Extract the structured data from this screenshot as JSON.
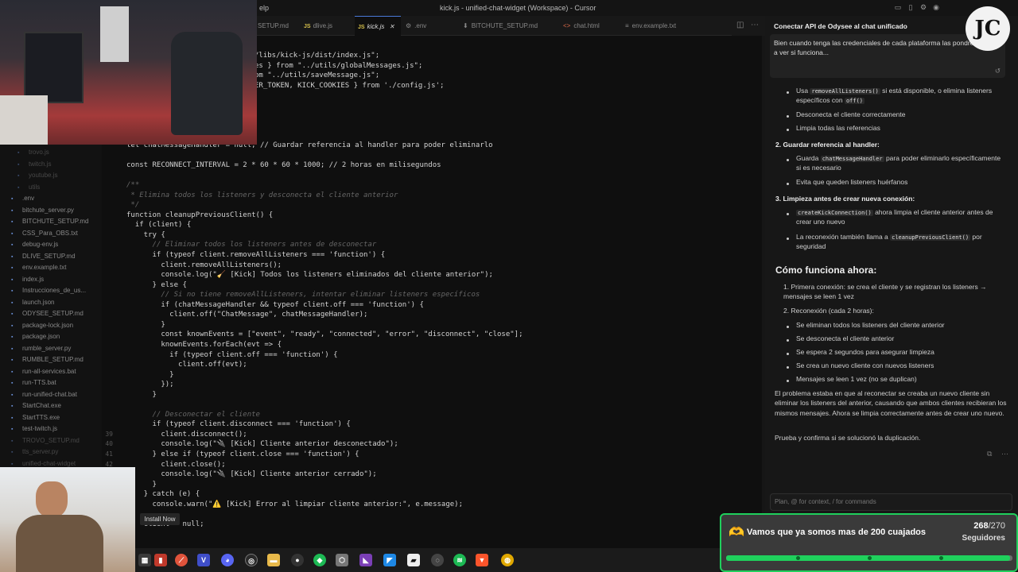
{
  "window": {
    "title": "kick.js - unified-chat-widget (Workspace) - Cursor",
    "menu_partial": "elp"
  },
  "tabs": [
    {
      "label": "SETUP.md",
      "type": "md"
    },
    {
      "label": "dlive.js",
      "type": "js"
    },
    {
      "label": "kick.js",
      "type": "js",
      "active": true
    },
    {
      "label": ".env",
      "type": "env"
    },
    {
      "label": "BITCHUTE_SETUP.md",
      "type": "md"
    },
    {
      "label": "chat.html",
      "type": "html"
    },
    {
      "label": "env.example.txt",
      "type": "txt"
    }
  ],
  "explorer": {
    "items": [
      "trovo.js",
      "twitch.js",
      "youtube.js",
      "utils",
      ".env",
      "bitchute_server.py",
      "BITCHUTE_SETUP.md",
      "CSS_Para_OBS.txt",
      "debug-env.js",
      "DLIVE_SETUP.md",
      "env.example.txt",
      "index.js",
      "Instrucciones_de_us...",
      "launch.json",
      "ODYSEE_SETUP.md",
      "package-lock.json",
      "package.json",
      "rumble_server.py",
      "RUMBLE_SETUP.md",
      "run-all-services.bat",
      "run-TTS.bat",
      "run-unified-chat.bat",
      "StartChat.exe",
      "StartTTS.exe",
      "test-twitch.js",
      "TROVO_SETUP.md",
      "tts_server.py",
      "unified-chat-widget"
    ]
  },
  "editor": {
    "lines": [
      {
        "n": "",
        "text": "/libs/kick-js/dist/index.js\";",
        "y": 0
      },
      {
        "n": "",
        "text": "es } from \"../utils/globalMessages.js\";",
        "y": 1
      },
      {
        "n": "",
        "text": "om \"../utils/saveMessage.js\";",
        "y": 2
      },
      {
        "n": "",
        "text": "ER_TOKEN, KICK_COOKIES } from './config.js';",
        "y": 3
      },
      {
        "n": "",
        "text": "let chatMessageHandler = null; // Guardar referencia al handler para poder eliminarlo",
        "y": 9
      },
      {
        "n": "",
        "text": "const RECONNECT_INTERVAL = 2 * 60 * 60 * 1000; // 2 horas en milisegundos",
        "y": 11
      },
      {
        "n": "",
        "text": "/**",
        "y": 13
      },
      {
        "n": "",
        "text": " * Elimina todos los listeners y desconecta el cliente anterior",
        "y": 14
      },
      {
        "n": "",
        "text": " */",
        "y": 15
      },
      {
        "n": "",
        "text": "function cleanupPreviousClient() {",
        "y": 16
      },
      {
        "n": "",
        "text": "  if (client) {",
        "y": 17
      },
      {
        "n": "",
        "text": "    try {",
        "y": 18
      },
      {
        "n": "",
        "text": "      // Eliminar todos los listeners antes de desconectar",
        "y": 19
      },
      {
        "n": "",
        "text": "      if (typeof client.removeAllListeners === 'function') {",
        "y": 20
      },
      {
        "n": "",
        "text": "        client.removeAllListeners();",
        "y": 21
      },
      {
        "n": "",
        "text": "        console.log(\"🧹 [Kick] Todos los listeners eliminados del cliente anterior\");",
        "y": 22
      },
      {
        "n": "",
        "text": "      } else {",
        "y": 23
      },
      {
        "n": "",
        "text": "        // Si no tiene removeAllListeners, intentar eliminar listeners específicos",
        "y": 24
      },
      {
        "n": "",
        "text": "        if (chatMessageHandler && typeof client.off === 'function') {",
        "y": 25
      },
      {
        "n": "",
        "text": "          client.off(\"ChatMessage\", chatMessageHandler);",
        "y": 26
      },
      {
        "n": "",
        "text": "        }",
        "y": 27
      },
      {
        "n": "",
        "text": "        const knownEvents = [\"event\", \"ready\", \"connected\", \"error\", \"disconnect\", \"close\"];",
        "y": 28
      },
      {
        "n": "",
        "text": "        knownEvents.forEach(evt => {",
        "y": 29
      },
      {
        "n": "",
        "text": "          if (typeof client.off === 'function') {",
        "y": 30
      },
      {
        "n": "",
        "text": "            client.off(evt);",
        "y": 31
      },
      {
        "n": "",
        "text": "          }",
        "y": 32
      },
      {
        "n": "",
        "text": "        });",
        "y": 33
      },
      {
        "n": "",
        "text": "      }",
        "y": 34
      },
      {
        "n": "",
        "text": "      // Desconectar el cliente",
        "y": 36
      },
      {
        "n": "",
        "text": "      if (typeof client.disconnect === 'function') {",
        "y": 37
      },
      {
        "n": "39",
        "text": "        client.disconnect();",
        "y": 38
      },
      {
        "n": "40",
        "text": "        console.log(\"🔌 [Kick] Cliente anterior desconectado\");",
        "y": 39
      },
      {
        "n": "41",
        "text": "      } else if (typeof client.close === 'function') {",
        "y": 40
      },
      {
        "n": "42",
        "text": "        client.close();",
        "y": 41
      },
      {
        "n": "43",
        "text": "        console.log(\"🔌 [Kick] Cliente anterior cerrado\");",
        "y": 42
      },
      {
        "n": "44",
        "text": "      }",
        "y": 43
      },
      {
        "n": "45",
        "text": "    } catch (e) {",
        "y": 44
      },
      {
        "n": "46",
        "text": "      console.warn(\"⚠️ [Kick] Error al limpiar cliente anterior:\", e.message);",
        "y": 45
      },
      {
        "n": "",
        "text": "    client = null;",
        "y": 47
      }
    ]
  },
  "install_button": "Install Now",
  "chat": {
    "header": "Conectar API de Odysee al chat unificado",
    "user_message": "Bien cuando tenga las credenciales de cada plataforma las pondré y te digo a ver si funciona...",
    "bullets_1": [
      {
        "pre": "Usa ",
        "code": "removeAllListeners()",
        "post": " si está disponible, o elimina listeners específicos con ",
        "code2": "off()"
      },
      {
        "text": "Desconecta el cliente correctamente"
      },
      {
        "text": "Limpia todas las referencias"
      }
    ],
    "heading_2": "2. Guardar referencia al handler:",
    "bullets_2": [
      {
        "pre": "Guarda ",
        "code": "chatMessageHandler",
        "post": " para poder eliminarlo específicamente si es necesario"
      },
      {
        "text": "Evita que queden listeners huérfanos"
      }
    ],
    "heading_3": "3. Limpieza antes de crear nueva conexión:",
    "bullets_3": [
      {
        "code": "createKickConnection()",
        "post": " ahora limpia el cliente anterior antes de crear uno nuevo"
      },
      {
        "pre": "La reconexión también llama a ",
        "code": "cleanupPreviousClient()",
        "post": " por seguridad"
      }
    ],
    "section_title": "Cómo funciona ahora:",
    "step_1": "1. Primera conexión: se crea el cliente y se registran los listeners → mensajes se leen 1 vez",
    "step_2": "2. Reconexión (cada 2 horas):",
    "bullets_4": [
      "Se eliminan todos los listeners del cliente anterior",
      "Se desconecta el cliente anterior",
      "Se espera 2 segundos para asegurar limpieza",
      "Se crea un nuevo cliente con nuevos listeners",
      "Mensajes se leen 1 vez (no se duplican)"
    ],
    "para_1": "El problema estaba en que al reconectar se creaba un nuevo cliente sin eliminar los listeners del anterior, causando que ambos clientes recibieran los mismos mensajes. Ahora se limpia correctamente antes de crear uno nuevo.",
    "para_2": "Prueba y confirma si se solucionó la duplicación.",
    "input_placeholder": "Plan, @ for context, / for commands"
  },
  "follow_goal": {
    "message": "Vamos que ya somos mas de 200 cuajados",
    "current": "268",
    "total": "/270",
    "label": "Seguidores",
    "progress": 0.9926
  },
  "colors": {
    "accent_green": "#1fd05c",
    "tab_active_border": "#4a7ad9"
  }
}
